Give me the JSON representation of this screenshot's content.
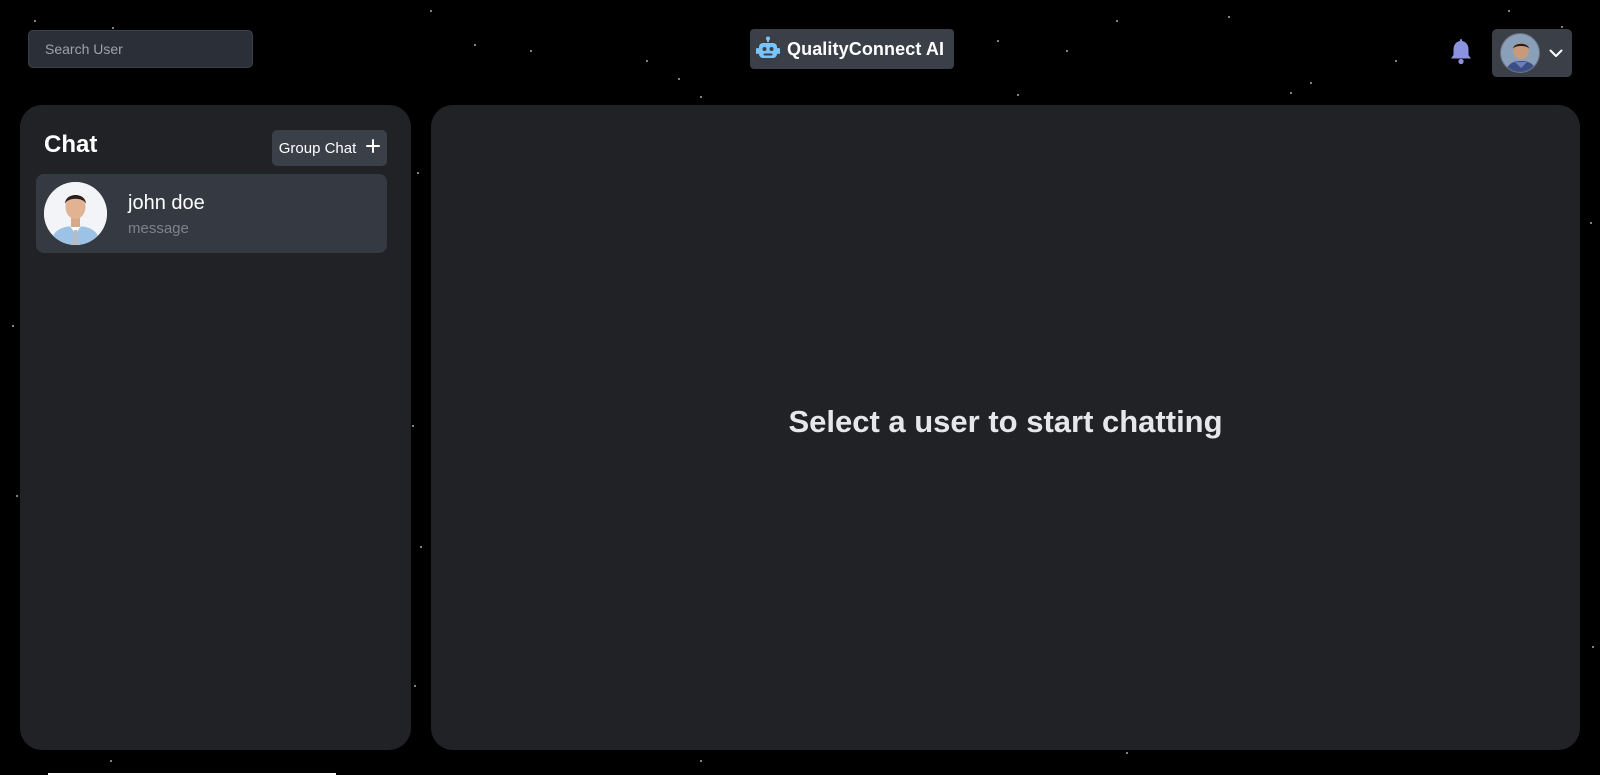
{
  "header": {
    "search_placeholder": "Search User",
    "brand_title": "QualityConnect AI",
    "brand_icon": "robot-icon",
    "notification_icon": "bell-icon",
    "profile_menu_icon": "chevron-down-icon"
  },
  "sidebar": {
    "title": "Chat",
    "group_chat_label": "Group Chat",
    "group_chat_icon": "plus-icon",
    "chats": [
      {
        "name": "john doe",
        "last_message": "message"
      }
    ]
  },
  "main": {
    "empty_state": "Select a user to start chatting"
  },
  "colors": {
    "background": "#000000",
    "panel": "#202226",
    "chip": "#3a3f48",
    "accent": "#7cc4f7",
    "bell": "#8b92e0"
  }
}
